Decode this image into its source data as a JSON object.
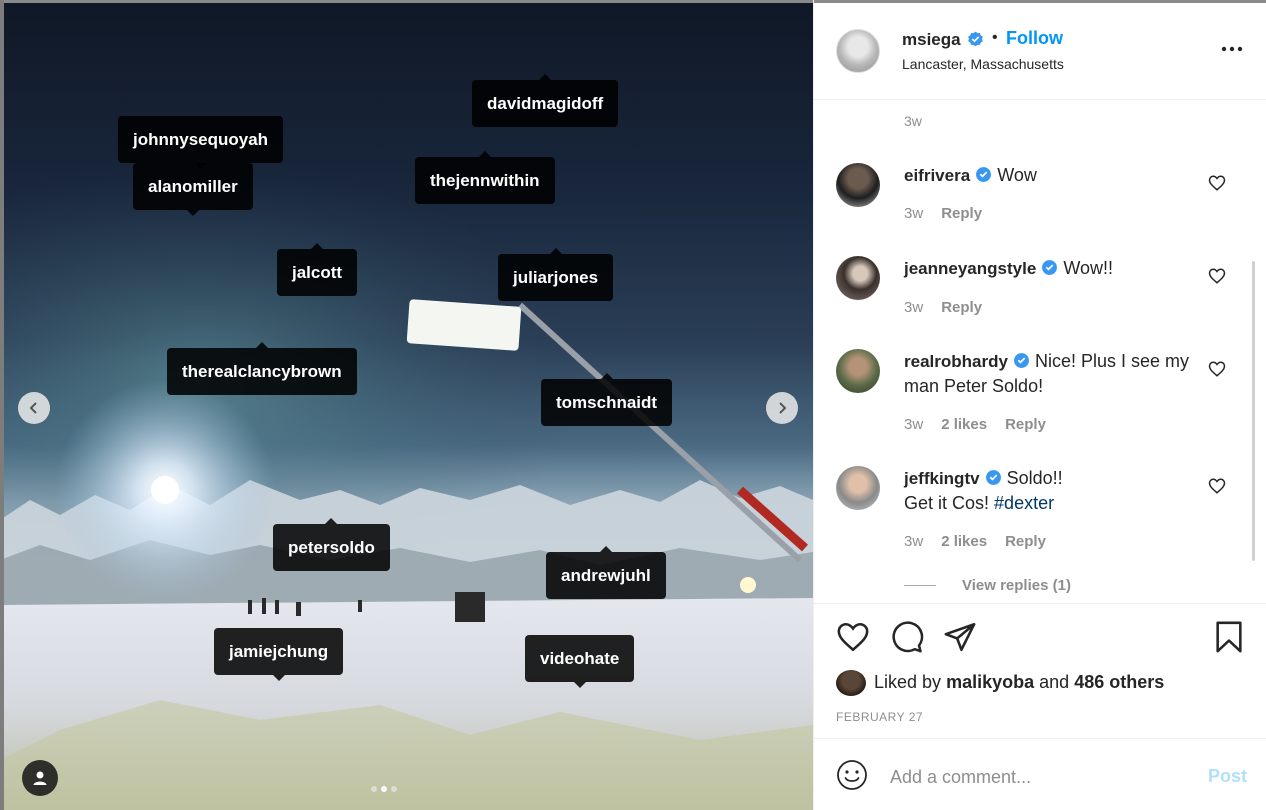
{
  "post": {
    "username": "msiega",
    "verified": true,
    "separator": "•",
    "follow_label": "Follow",
    "location": "Lancaster, Massachusetts",
    "more_icon": "more-horizontal-icon"
  },
  "media": {
    "tags": [
      {
        "name": "johnnysequoyah"
      },
      {
        "name": "davidmagidoff"
      },
      {
        "name": "alanomiller"
      },
      {
        "name": "thejennwithin"
      },
      {
        "name": "jalcott"
      },
      {
        "name": "juliarjones"
      },
      {
        "name": "therealclancybrown"
      },
      {
        "name": "tomschnaidt"
      },
      {
        "name": "petersoldo"
      },
      {
        "name": "andrewjuhl"
      },
      {
        "name": "jamiejchung"
      },
      {
        "name": "videohate"
      }
    ],
    "carousel": {
      "count": 3,
      "active": 2
    },
    "icons": {
      "prev": "chevron-left-icon",
      "next": "chevron-right-icon",
      "tagged_users": "user-icon"
    }
  },
  "comments": {
    "previous_time": "3w",
    "items": [
      {
        "user": "eifrivera",
        "verified": true,
        "text": "Wow",
        "time": "3w",
        "likes": "",
        "reply": "Reply"
      },
      {
        "user": "jeanneyangstyle",
        "verified": true,
        "text": "Wow!!",
        "time": "3w",
        "likes": "",
        "reply": "Reply"
      },
      {
        "user": "realrobhardy",
        "verified": true,
        "text": "Nice! Plus I see my man Peter Soldo!",
        "time": "3w",
        "likes": "2 likes",
        "reply": "Reply"
      },
      {
        "user": "jeffkingtv",
        "verified": true,
        "text_line1": "Soldo!!",
        "text_line2": "Get it Cos!",
        "hashtag": "#dexter",
        "time": "3w",
        "likes": "2 likes",
        "reply": "Reply"
      }
    ],
    "view_replies": "View replies (1)"
  },
  "actions": {
    "icons": [
      "heart-icon",
      "comment-icon",
      "share-icon",
      "bookmark-icon"
    ],
    "liked_prefix": "Liked by",
    "liked_user": "malikyoba",
    "liked_and": "and",
    "liked_others": "486 others",
    "date": "FEBRUARY 27"
  },
  "add_comment": {
    "placeholder": "Add a comment...",
    "post_label": "Post"
  },
  "colors": {
    "link_blue": "#0095f6",
    "post_disabled": "#b2dffc",
    "secondary_text": "#8e8e8e",
    "verified": "#3897f0"
  }
}
